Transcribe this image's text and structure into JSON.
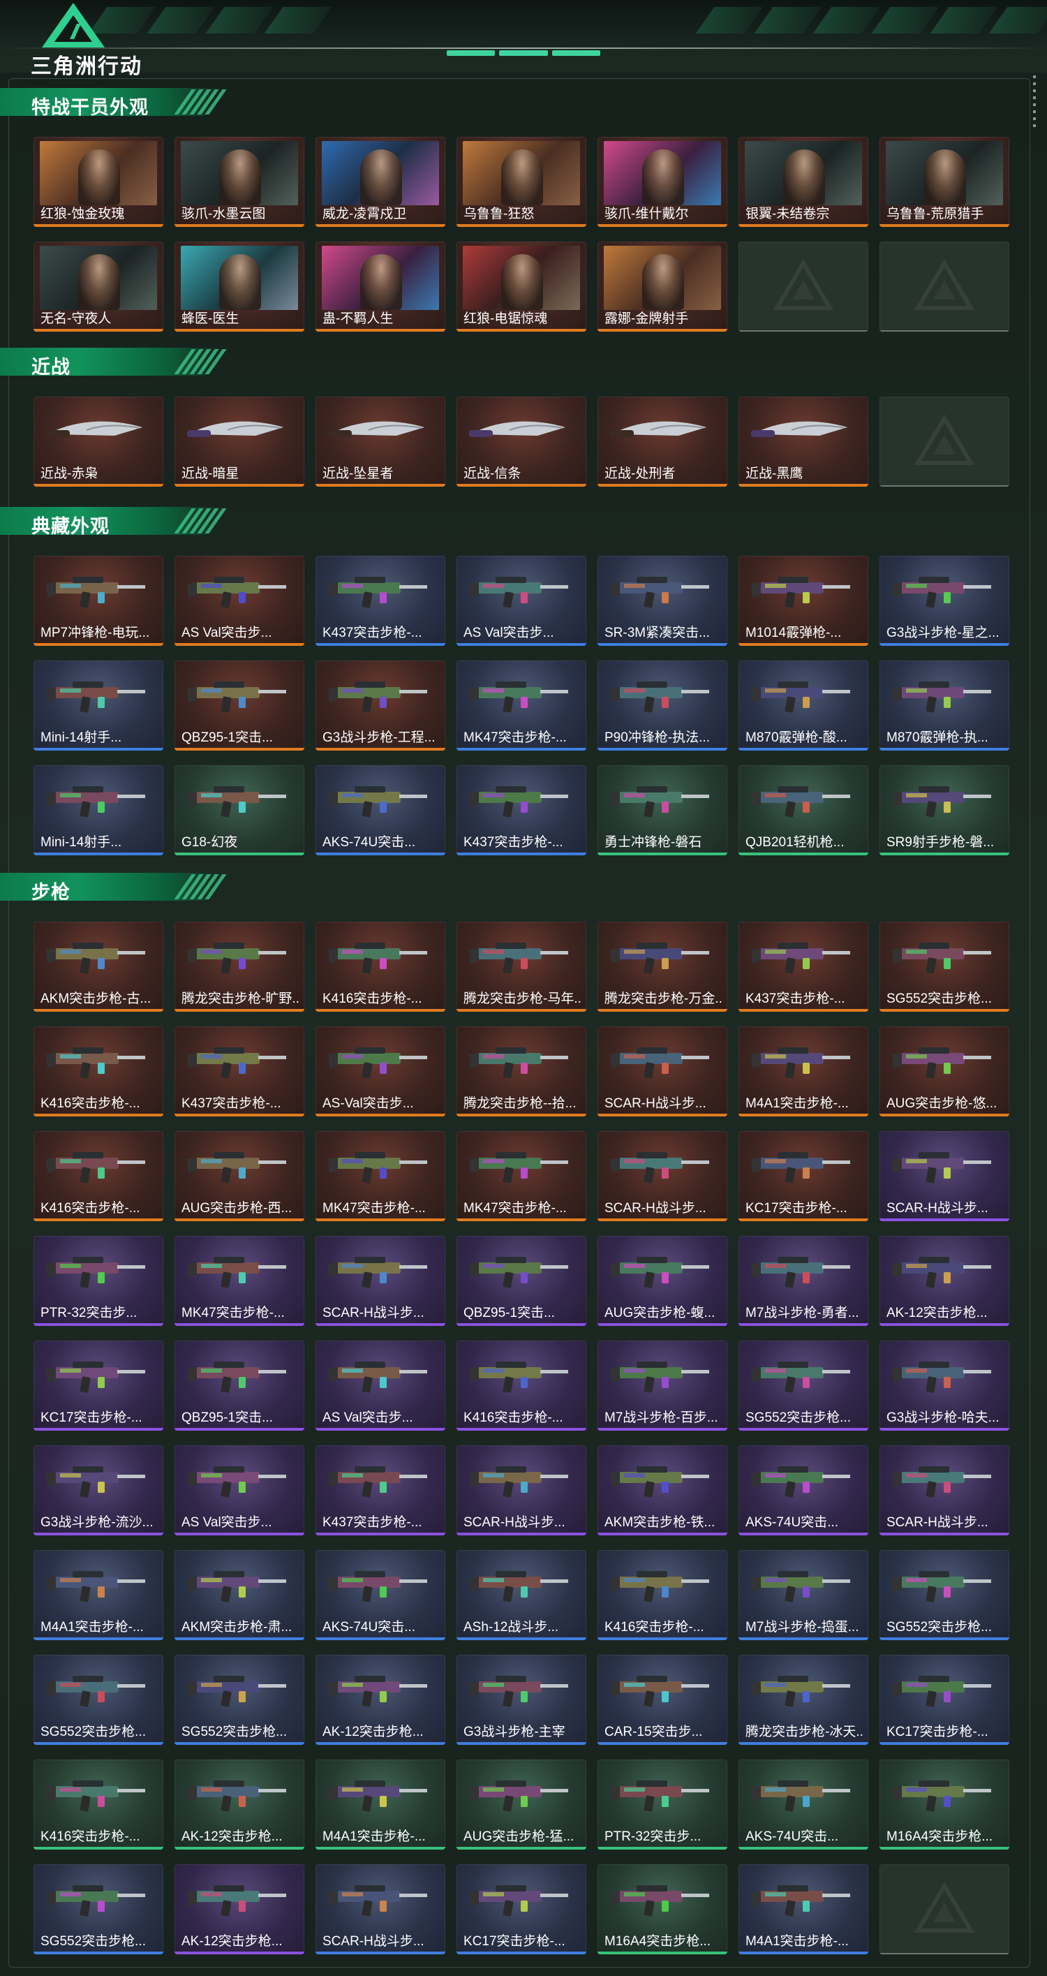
{
  "app": {
    "title": "三角洲行动"
  },
  "sections": [
    {
      "title": "特战干员外观",
      "items": [
        "红狼-蚀金玫瑰",
        "骇爪-水墨云图",
        "威龙-凌霄戍卫",
        "乌鲁鲁-狂怒",
        "骇爪-维什戴尔",
        "银翼-未结卷宗",
        "乌鲁鲁-荒原猎手",
        "无名-守夜人",
        "蜂医-医生",
        "蛊-不羁人生",
        "红狼-电锯惊魂",
        "露娜-金牌射手"
      ]
    },
    {
      "title": "近战",
      "items": [
        "近战-赤枭",
        "近战-暗星",
        "近战-坠星者",
        "近战-信条",
        "近战-处刑者",
        "近战-黑鹰"
      ]
    },
    {
      "title": "典藏外观",
      "items": [
        "MP7冲锋枪-电玩...",
        "AS Val突击步...",
        "K437突击步枪-...",
        "AS Val突击步...",
        "SR-3M紧凑突击...",
        "M1014霰弹枪-...",
        "G3战斗步枪-星之...",
        "Mini-14射手...",
        "QBZ95-1突击...",
        "G3战斗步枪-工程...",
        "MK47突击步枪-...",
        "P90冲锋枪-执法...",
        "M870霰弹枪-酸...",
        "M870霰弹枪-执...",
        "Mini-14射手...",
        "G18-幻夜",
        "AKS-74U突击...",
        "K437突击步枪-...",
        "勇士冲锋枪-磐石",
        "QJB201轻机枪...",
        "SR9射手步枪-磐..."
      ]
    },
    {
      "title": "步枪",
      "items": [
        "AKM突击步枪-古...",
        "腾龙突击步枪-旷野...",
        "K416突击步枪-...",
        "腾龙突击步枪-马年...",
        "腾龙突击步枪-万金...",
        "K437突击步枪-...",
        "SG552突击步枪...",
        "K416突击步枪-...",
        "K437突击步枪-...",
        "AS-Val突击步...",
        "腾龙突击步枪--拾...",
        "SCAR-H战斗步...",
        "M4A1突击步枪-...",
        "AUG突击步枪-悠...",
        "K416突击步枪-...",
        "AUG突击步枪-西...",
        "MK47突击步枪-...",
        "MK47突击步枪-...",
        "SCAR-H战斗步...",
        "KC17突击步枪-...",
        "SCAR-H战斗步...",
        "PTR-32突击步...",
        "MK47突击步枪-...",
        "SCAR-H战斗步...",
        "QBZ95-1突击...",
        "AUG突击步枪-蝮...",
        "M7战斗步枪-勇者...",
        "AK-12突击步枪...",
        "KC17突击步枪-...",
        "QBZ95-1突击...",
        "AS Val突击步...",
        "K416突击步枪-...",
        "M7战斗步枪-百步...",
        "SG552突击步枪...",
        "G3战斗步枪-哈夫...",
        "G3战斗步枪-流沙...",
        "AS Val突击步...",
        "K437突击步枪-...",
        "SCAR-H战斗步...",
        "AKM突击步枪-铁...",
        "AKS-74U突击...",
        "SCAR-H战斗步...",
        "M4A1突击步枪-...",
        "AKM突击步枪-肃...",
        "AKS-74U突击...",
        "ASh-12战斗步...",
        "K416突击步枪-...",
        "M7战斗步枪-捣蛋...",
        "SG552突击步枪...",
        "SG552突击步枪...",
        "SG552突击步枪...",
        "AK-12突击步枪...",
        "G3战斗步枪-主宰",
        "CAR-15突击步...",
        "腾龙突击步枪-冰天...",
        "KC17突击步枪-...",
        "K416突击步枪-...",
        "AK-12突击步枪...",
        "M4A1突击步枪-...",
        "AUG突击步枪-猛...",
        "PTR-32突击步...",
        "AKS-74U突击...",
        "M16A4突击步枪...",
        "SG552突击步枪...",
        "AK-12突击步枪...",
        "SCAR-H战斗步...",
        "KC17突击步枪-...",
        "M16A4突击步枪...",
        "M4A1突击步枪-..."
      ]
    }
  ]
}
